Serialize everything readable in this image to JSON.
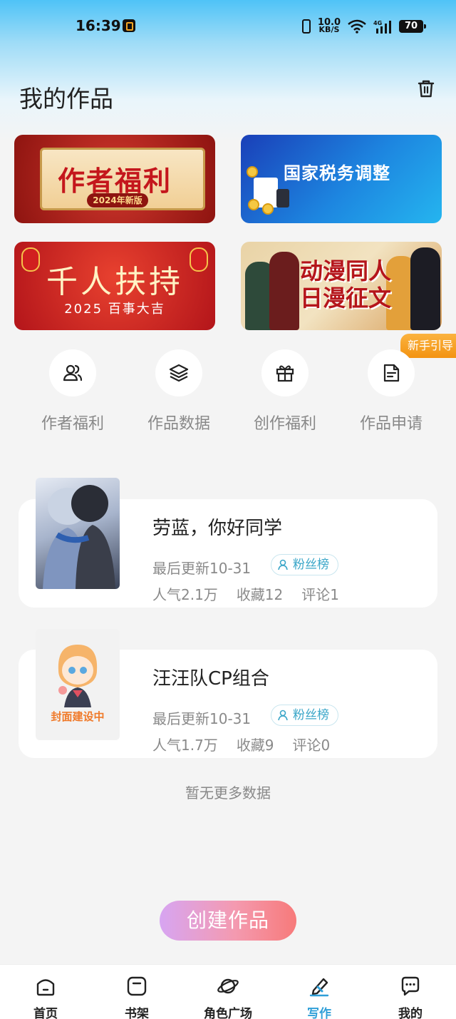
{
  "status_bar": {
    "time": "16:39",
    "net_speed_value": "10.0",
    "net_speed_unit": "KB/S",
    "network_type": "4G",
    "battery": "70"
  },
  "header": {
    "title": "我的作品",
    "trash_icon": "trash-icon"
  },
  "banners": [
    {
      "title": "作者福利",
      "subtitle": "2024年新版"
    },
    {
      "title": "国家税务调整"
    },
    {
      "title": "千人扶持",
      "subtitle": "2025 百事大吉"
    },
    {
      "title_line1": "动漫同人",
      "title_line2": "日漫征文"
    }
  ],
  "guide_badge": "新手引导",
  "quick_actions": [
    {
      "label": "作者福利",
      "icon": "users-icon"
    },
    {
      "label": "作品数据",
      "icon": "layers-icon"
    },
    {
      "label": "创作福利",
      "icon": "gift-icon"
    },
    {
      "label": "作品申请",
      "icon": "document-icon"
    }
  ],
  "works": [
    {
      "title": "劳蓝，你好同学",
      "updated": "最后更新10-31",
      "fans_label": "粉丝榜",
      "popularity": "人气2.1万",
      "favorites": "收藏12",
      "comments": "评论1"
    },
    {
      "title": "汪汪队CP组合",
      "updated": "最后更新10-31",
      "fans_label": "粉丝榜",
      "popularity": "人气1.7万",
      "favorites": "收藏9",
      "comments": "评论0",
      "cover_text": "封面建设中"
    }
  ],
  "no_more": "暂无更多数据",
  "create_button": "创建作品",
  "bottom_nav": [
    {
      "label": "首页",
      "icon": "home-icon",
      "active": false
    },
    {
      "label": "书架",
      "icon": "bookshelf-icon",
      "active": false
    },
    {
      "label": "角色广场",
      "icon": "planet-icon",
      "active": false
    },
    {
      "label": "写作",
      "icon": "pen-icon",
      "active": true
    },
    {
      "label": "我的",
      "icon": "chat-bubble-icon",
      "active": false
    }
  ],
  "colors": {
    "accent": "#2f9fd8",
    "guide_badge": "#f39312",
    "fans_tag": "#3aa6c8"
  }
}
